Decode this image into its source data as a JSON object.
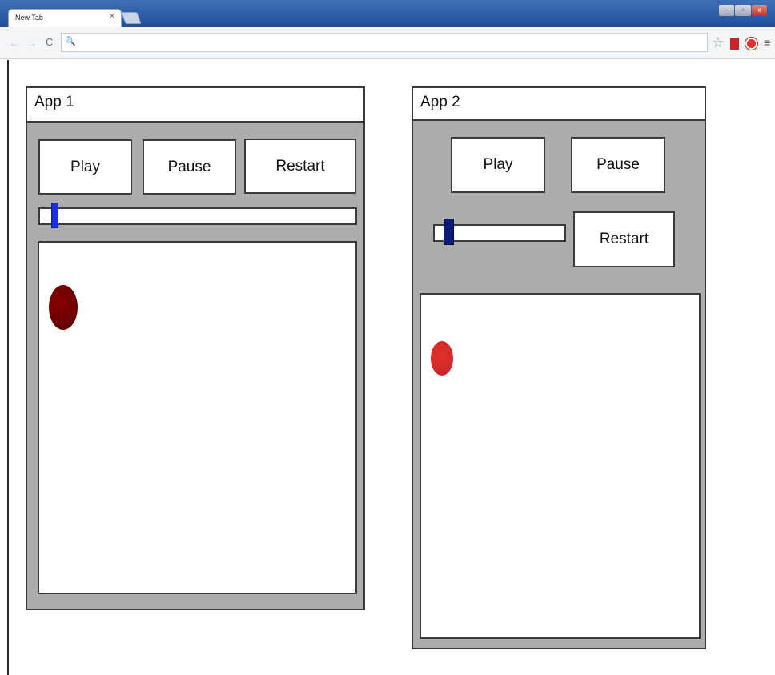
{
  "browser": {
    "tab_title": "New Tab",
    "tab_close": "×",
    "window_controls": [
      "–",
      "▫",
      "x"
    ],
    "back_icon": "←",
    "forward_icon": "→",
    "reload_icon": "C",
    "omnibox_icon": "🔍",
    "omnibox_value": "",
    "star_icon": "☆",
    "menu_icon": "≡"
  },
  "app1": {
    "title": "App 1",
    "buttons": {
      "play": "Play",
      "pause": "Pause",
      "restart": "Restart"
    },
    "slider_value": 0.04,
    "ball_color": "#870000"
  },
  "app2": {
    "title": "App 2",
    "buttons": {
      "play": "Play",
      "pause": "Pause",
      "restart": "Restart"
    },
    "slider_value": 0.08,
    "ball_color": "#e03030"
  },
  "colors": {
    "panel_bg": "#acacac",
    "app1_slider_thumb": "#1a2fe0",
    "app2_slider_thumb": "#0b1a78"
  }
}
